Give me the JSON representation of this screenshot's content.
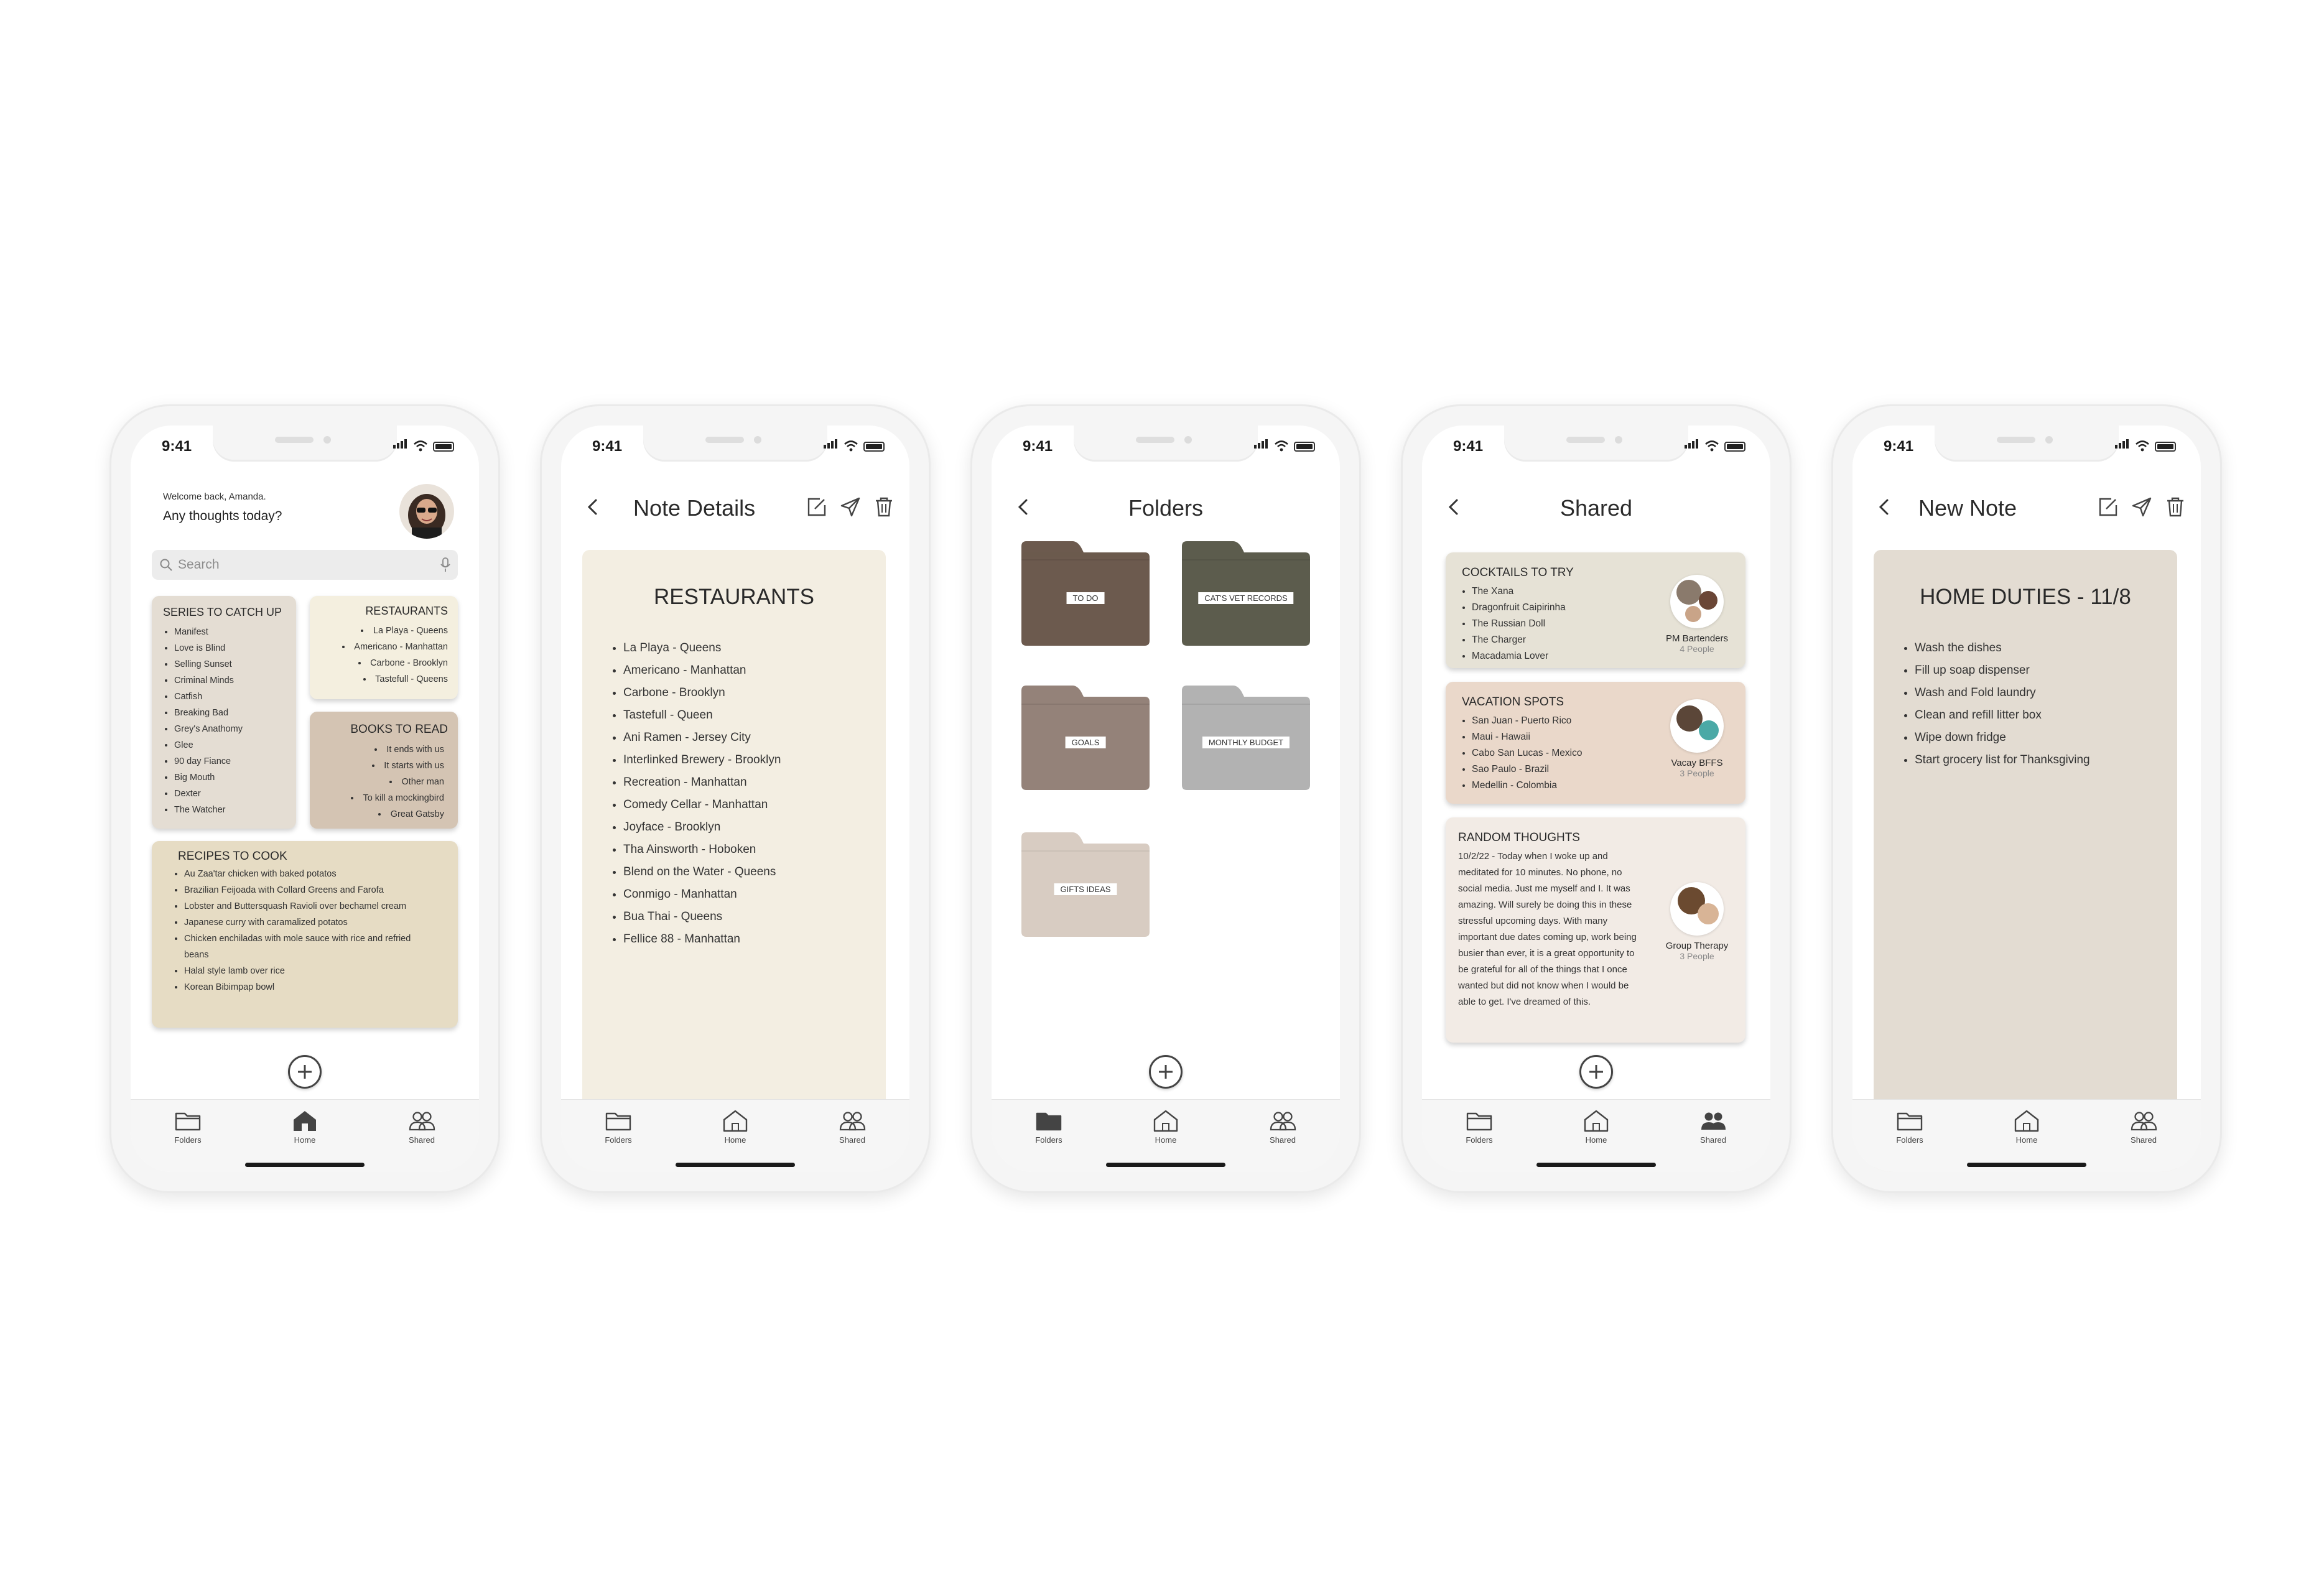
{
  "status": {
    "time": "9:41"
  },
  "colors": {
    "beige1": "#e4ddd3",
    "cream": "#f4efdf",
    "tan": "#d4c4b3",
    "sand": "#e6dcc4",
    "notebg": "#f3eee2",
    "homenotebg": "#e3dcd2"
  },
  "tabs": {
    "folders": "Folders",
    "home": "Home",
    "shared": "Shared"
  },
  "home": {
    "welcome": "Welcome back, Amanda.",
    "question": "Any thoughts today?",
    "search_placeholder": "Search",
    "notes": {
      "series": {
        "title": "SERIES TO CATCH UP",
        "items": [
          "Manifest",
          "Love is Blind",
          "Selling Sunset",
          "Criminal Minds",
          "Catfish",
          "Breaking Bad",
          "Grey's Anathomy",
          "Glee",
          "90 day Fiance",
          "Big Mouth",
          "Dexter",
          "The Watcher"
        ]
      },
      "restaurants": {
        "title": "RESTAURANTS",
        "items": [
          "La Playa - Queens",
          "Americano - Manhattan",
          "Carbone - Brooklyn",
          "Tastefull - Queens"
        ]
      },
      "books": {
        "title": "BOOKS TO READ",
        "items": [
          "It ends with us",
          "It starts with us",
          "Other man",
          "To kill a mockingbird",
          "Great Gatsby"
        ]
      },
      "recipes": {
        "title": "RECIPES TO COOK",
        "items": [
          "Au Zaa'tar chicken with baked potatos",
          "Brazilian Feijoada with Collard Greens and Farofa",
          "Lobster and Buttersquash Ravioli over bechamel cream",
          "Japanese curry with caramalized potatos",
          "Chicken enchiladas with mole sauce with rice and refried beans",
          "Halal style lamb over rice",
          "Korean Bibimpap bowl"
        ]
      }
    }
  },
  "details": {
    "header": "Note Details",
    "title": "RESTAURANTS",
    "items": [
      "La Playa - Queens",
      "Americano - Manhattan",
      "Carbone - Brooklyn",
      "Tastefull - Queen",
      "Ani Ramen - Jersey City",
      "Interlinked Brewery - Brooklyn",
      "Recreation - Manhattan",
      "Comedy Cellar - Manhattan",
      "Joyface - Brooklyn",
      "Tha Ainsworth - Hoboken",
      "Blend on the Water - Queens",
      "Conmigo - Manhattan",
      "Bua Thai - Queens",
      "Fellice 88 - Manhattan"
    ]
  },
  "folders": {
    "header": "Folders",
    "items": [
      {
        "label": "TO DO",
        "color": "#6c5a4e"
      },
      {
        "label": "CAT'S VET RECORDS",
        "color": "#5c5c4d"
      },
      {
        "label": "GOALS",
        "color": "#948279"
      },
      {
        "label": "MONTHLY BUDGET",
        "color": "#b2b2b2"
      },
      {
        "label": "GIFTS IDEAS",
        "color": "#d8ccc2"
      }
    ]
  },
  "shared": {
    "header": "Shared",
    "cards": [
      {
        "title": "COCKTAILS TO TRY",
        "items": [
          "The Xana",
          "Dragonfruit Caipirinha",
          "The Russian Doll",
          "The Charger",
          "Macadamia Lover"
        ],
        "group": "PM Bartenders",
        "count": "4 People",
        "color": "#e6e2d6"
      },
      {
        "title": "VACATION SPOTS",
        "items": [
          "San Juan - Puerto Rico",
          "Maui - Hawaii",
          "Cabo San Lucas - Mexico",
          "Sao Paulo - Brazil",
          "Medellin - Colombia"
        ],
        "group": "Vacay BFFS",
        "count": "3 People",
        "color": "#ead8ca"
      },
      {
        "title": "RANDOM THOUGHTS",
        "text": "10/2/22 - Today when I woke up and meditated for 10 minutes. No phone, no social media. Just me myself and I. It was amazing. Will surely be doing this in these stressful upcoming days. With many important due dates coming up, work being busier than ever, it is a great opportunity to be grateful for all of the things that I once wanted but did not know when I would be able to get. I've dreamed of this.",
        "group": "Group Therapy",
        "count": "3 People",
        "color": "#f2ebe5"
      }
    ]
  },
  "newnote": {
    "header": "New Note",
    "title": "HOME DUTIES - 11/8",
    "items": [
      "Wash the dishes",
      "Fill up soap dispenser",
      "Wash and Fold laundry",
      "Clean and refill litter box",
      "Wipe down fridge",
      "Start grocery list for Thanksgiving"
    ]
  }
}
